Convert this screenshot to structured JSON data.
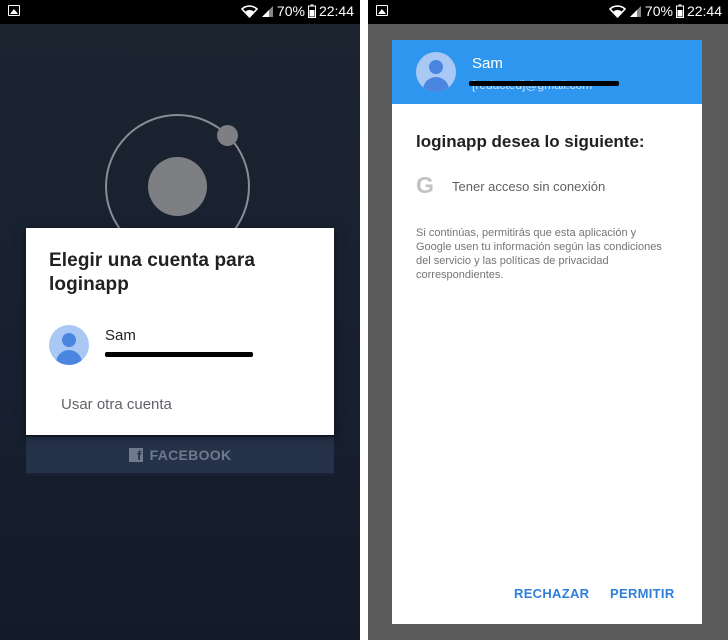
{
  "status_bar": {
    "battery": "70%",
    "time": "22:44"
  },
  "left_screen": {
    "account_dialog": {
      "title": "Elegir una cuenta para loginapp",
      "account": {
        "name": "Sam",
        "email": "[redacted]@gmail.com"
      },
      "other_account_label": "Usar otra cuenta"
    },
    "facebook_button": {
      "label": "FACEBOOK"
    }
  },
  "right_screen": {
    "header": {
      "name": "Sam",
      "email": "[redacted]@gmail.com"
    },
    "title": "loginapp desea lo siguiente:",
    "permission": {
      "label": "Tener acceso sin conexión",
      "icon": "google-g-icon"
    },
    "disclaimer": "Si continúas, permitirás que esta aplicación y Google usen tu información según las condiciones del servicio y las políticas de privacidad correspondientes.",
    "actions": {
      "reject": "RECHAZAR",
      "allow": "PERMITIR"
    }
  },
  "colors": {
    "header_blue": "#2f96ef",
    "action_blue": "#2f7fd9",
    "avatar_blue": "#4a86e0",
    "avatar_bg": "#a9c8f3",
    "facebook_button_bg": "#26324a"
  }
}
